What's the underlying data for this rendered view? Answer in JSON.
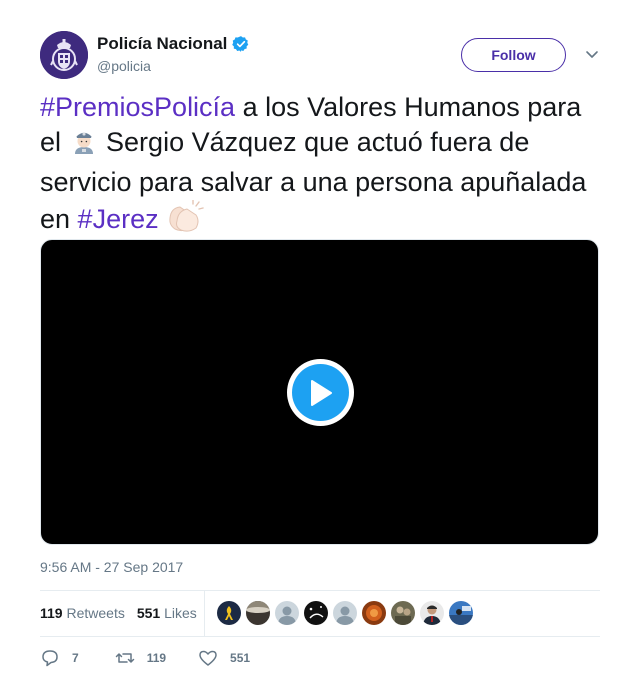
{
  "author": {
    "display_name": "Policía Nacional",
    "handle": "@policia",
    "verified": true,
    "avatar_icon": "police-emblem-icon",
    "verified_icon": "verified-badge-icon"
  },
  "follow_label": "Follow",
  "tweet": {
    "hashtag_1": "#PremiosPolicía",
    "text_1": " a los Valores Humanos para el ",
    "emoji_1": "police-officer-emoji",
    "text_2": " Sergio Vázquez que actuó fuera de servicio para salvar a una persona apuñalada en ",
    "hashtag_2": "#Jerez",
    "emoji_2": "clapping-hands-emoji"
  },
  "video": {
    "play_icon": "play-icon"
  },
  "timestamp": "9:56 AM - 27 Sep 2017",
  "stats": {
    "retweets_count": "119",
    "retweets_label": "Retweets",
    "likes_count": "551",
    "likes_label": "Likes"
  },
  "actions": {
    "reply_count": "7",
    "retweet_count": "119",
    "like_count": "551"
  },
  "colors": {
    "accent": "#4a2fa8",
    "hashtag": "#5b2fc4",
    "play_blue": "#1da1f2",
    "muted": "#657786"
  }
}
